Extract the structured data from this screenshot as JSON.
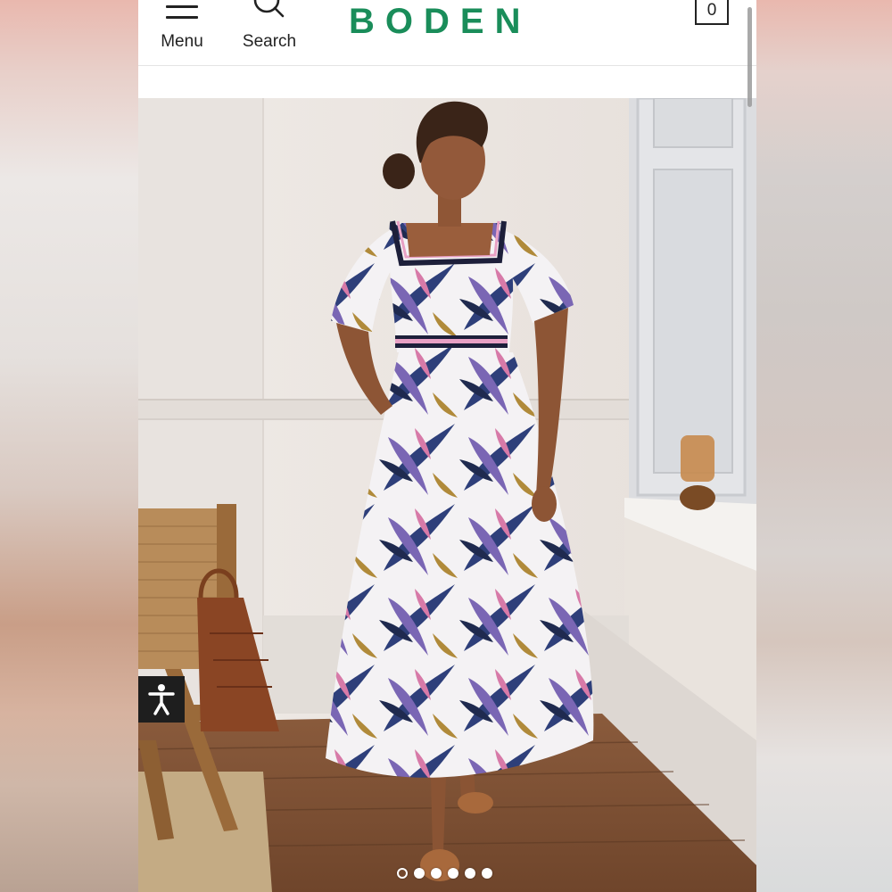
{
  "header": {
    "menu_label": "Menu",
    "search_label": "Search",
    "brand": "BODEN",
    "bag_count": "0"
  },
  "carousel": {
    "slide_count": 6,
    "active_index": 0
  },
  "icons": {
    "menu": "hamburger-icon",
    "search": "search-icon",
    "bag": "shopping-bag-icon",
    "accessibility": "accessibility-icon"
  },
  "colors": {
    "brand": "#1a8d5a",
    "text": "#222222",
    "accessibility_bg": "#1e1e1e"
  }
}
